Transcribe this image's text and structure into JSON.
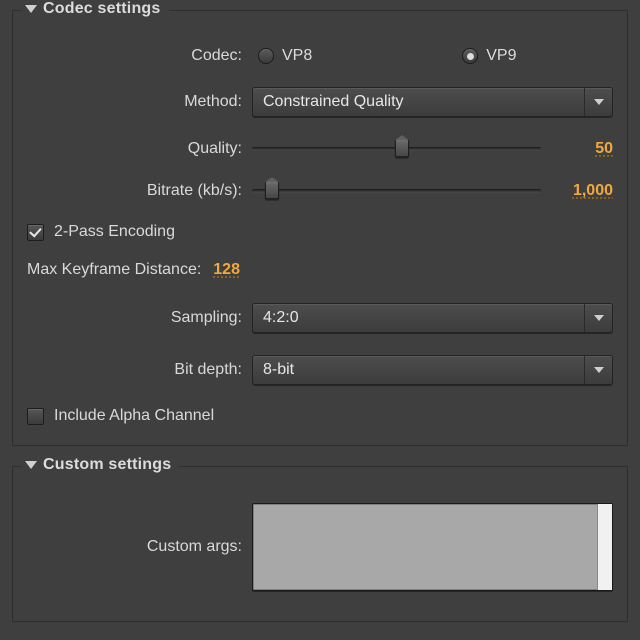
{
  "codec_section": {
    "title": "Codec settings",
    "codec": {
      "label": "Codec:",
      "options": [
        {
          "label": "VP8",
          "selected": false
        },
        {
          "label": "VP9",
          "selected": true
        }
      ]
    },
    "method": {
      "label": "Method:",
      "value": "Constrained Quality"
    },
    "quality": {
      "label": "Quality:",
      "value": "50",
      "percent": 52
    },
    "bitrate": {
      "label": "Bitrate (kb/s):",
      "value": "1,000",
      "percent": 7
    },
    "two_pass": {
      "label": "2-Pass Encoding",
      "checked": true
    },
    "max_keyframe": {
      "label": "Max Keyframe Distance:",
      "value": "128"
    },
    "sampling": {
      "label": "Sampling:",
      "value": "4:2:0"
    },
    "bit_depth": {
      "label": "Bit depth:",
      "value": "8-bit"
    },
    "include_alpha": {
      "label": "Include Alpha Channel",
      "checked": false
    }
  },
  "custom_section": {
    "title": "Custom settings",
    "custom_args_label": "Custom args:"
  }
}
